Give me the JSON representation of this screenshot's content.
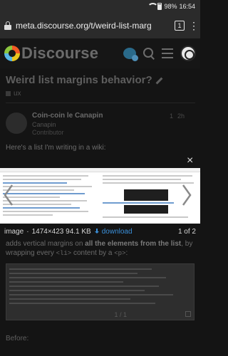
{
  "status_bar": {
    "battery": "98%",
    "time": "16:54"
  },
  "browser": {
    "url": "meta.discourse.org/t/weird-list-marg",
    "tab_count": "1"
  },
  "site": {
    "logo_text": "Discourse"
  },
  "topic": {
    "title": "Weird list margins behavior?",
    "category": "ux"
  },
  "post": {
    "author_name": "Coin-coin le Canapin",
    "username": "Canapin",
    "role": "Contributor",
    "edit_count": "1",
    "age": "2h",
    "intro": "Here's a list I'm writing in a wiki:"
  },
  "lightbox": {
    "close": "×",
    "caption_name": "image",
    "caption_meta": "1474×423 94.1 KB",
    "download_label": "download",
    "counter": "1 of 2"
  },
  "body": {
    "line1_start": "adds vertical margins on",
    "line1_bold": "all the elements from the list",
    "line1_end": ", by",
    "line2_start": "wrapping every",
    "line2_code": "<li>",
    "line2_mid": "content by a",
    "line2_code2": "<p>",
    "line2_end": ":"
  },
  "second_image": {
    "counter": "1 / 1"
  },
  "before_label": "Before:"
}
